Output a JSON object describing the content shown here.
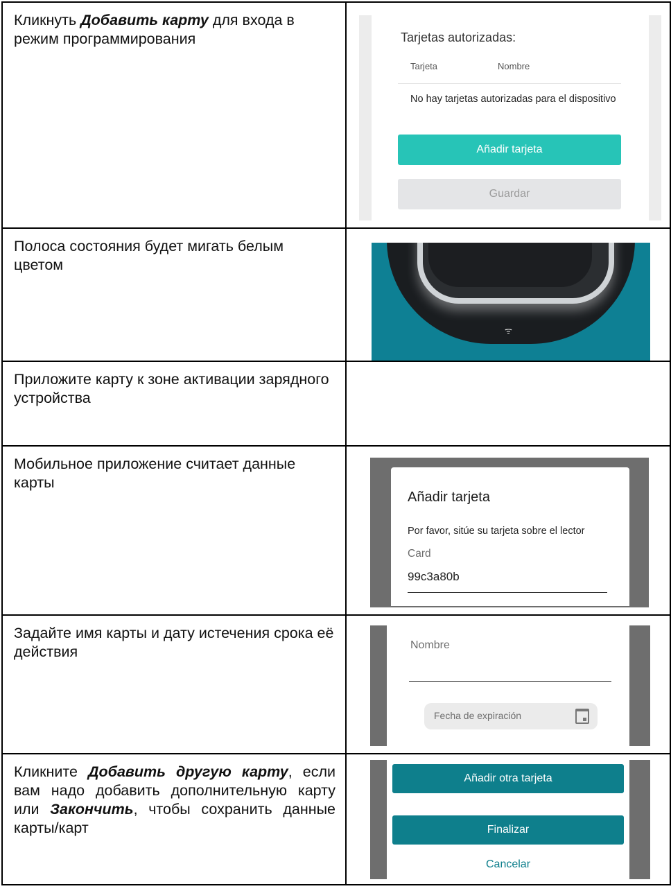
{
  "steps": [
    {
      "pre": "Кликнуть ",
      "em": "Добавить карту",
      "post": " для входа в режим программирования"
    },
    {
      "text": "Полоса состояния будет мигать белым цветом"
    },
    {
      "text": "Приложите карту к зоне активации зарядного устройства"
    },
    {
      "text": "Мобильное приложение считает данные карты"
    },
    {
      "text": "Задайте имя карты и дату истечения срока её действия"
    },
    {
      "pre": "Кликните ",
      "em1": "Добавить другую карту",
      "mid": ", если вам надо добавить дополнительную карту или ",
      "em2": "Закончить",
      "post": ", чтобы сохранить данные карты/карт"
    }
  ],
  "panel_authorized": {
    "title": "Tarjetas autorizadas:",
    "col_card": "Tarjeta",
    "col_name": "Nombre",
    "empty_msg": "No hay tarjetas autorizadas para el dispositivo",
    "add_label": "Añadir tarjeta",
    "save_label": "Guardar",
    "colors": {
      "add": "#27c4b7",
      "save": "#e4e5e7"
    }
  },
  "device": {
    "icon": "wifi-icon",
    "colors": {
      "body": "#0e8094",
      "ring": "#cfd3d6"
    }
  },
  "dialog": {
    "title": "Añadir tarjeta",
    "message": "Por favor, sitúe su tarjeta sobre el lector",
    "card_label": "Card",
    "card_value": "99c3a80b"
  },
  "form": {
    "name_label": "Nombre",
    "expiry_placeholder": "Fecha de expiración",
    "expiry_icon": "calendar-icon"
  },
  "actions": {
    "add_other": "Añadir otra tarjeta",
    "finish": "Finalizar",
    "cancel": "Cancelar",
    "colors": {
      "primary": "#0e7f8c"
    }
  }
}
